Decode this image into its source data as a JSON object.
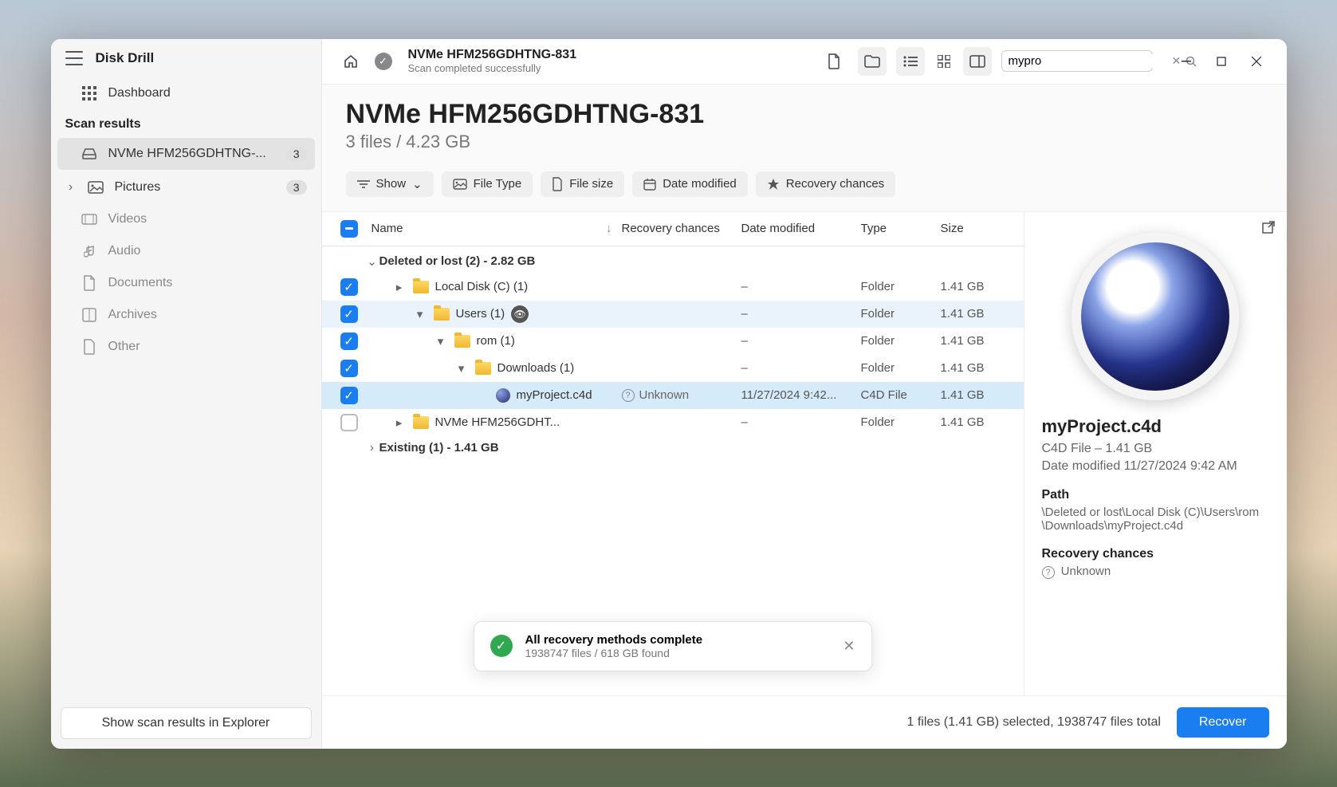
{
  "app": {
    "title": "Disk Drill"
  },
  "sidebar": {
    "dashboard": "Dashboard",
    "section": "Scan results",
    "items": [
      {
        "label": "NVMe HFM256GDHTNG-...",
        "badge": "3"
      },
      {
        "label": "Pictures",
        "badge": "3"
      },
      {
        "label": "Videos"
      },
      {
        "label": "Audio"
      },
      {
        "label": "Documents"
      },
      {
        "label": "Archives"
      },
      {
        "label": "Other"
      }
    ],
    "explorer_button": "Show scan results in Explorer"
  },
  "topbar": {
    "breadcrumb_title": "NVMe HFM256GDHTNG-831",
    "breadcrumb_sub": "Scan completed successfully",
    "search_value": "mypro"
  },
  "header": {
    "title": "NVMe HFM256GDHTNG-831",
    "subtitle": "3 files / 4.23 GB"
  },
  "filters": {
    "show": "Show",
    "file_type": "File Type",
    "file_size": "File size",
    "date_modified": "Date modified",
    "recovery": "Recovery chances"
  },
  "columns": {
    "name": "Name",
    "recovery": "Recovery chances",
    "date": "Date modified",
    "type": "Type",
    "size": "Size"
  },
  "groups": [
    {
      "label": "Deleted or lost (2) - 2.82 GB"
    },
    {
      "label": "Existing (1) - 1.41 GB"
    }
  ],
  "rows": [
    {
      "name": "Local Disk (C) (1)",
      "rec": "",
      "date": "–",
      "type": "Folder",
      "size": "1.41 GB",
      "indent": 1,
      "checked": true,
      "kind": "folder",
      "chev": "▸"
    },
    {
      "name": "Users (1)",
      "rec": "",
      "date": "–",
      "type": "Folder",
      "size": "1.41 GB",
      "indent": 2,
      "checked": true,
      "kind": "folder",
      "chev": "▾",
      "eye": true,
      "hover": true
    },
    {
      "name": "rom (1)",
      "rec": "",
      "date": "–",
      "type": "Folder",
      "size": "1.41 GB",
      "indent": 3,
      "checked": true,
      "kind": "folder",
      "chev": "▾"
    },
    {
      "name": "Downloads (1)",
      "rec": "",
      "date": "–",
      "type": "Folder",
      "size": "1.41 GB",
      "indent": 4,
      "checked": true,
      "kind": "folder",
      "chev": "▾"
    },
    {
      "name": "myProject.c4d",
      "rec": "Unknown",
      "date": "11/27/2024 9:42...",
      "type": "C4D File",
      "size": "1.41 GB",
      "indent": 5,
      "checked": true,
      "kind": "file",
      "selected": true
    },
    {
      "name": "NVMe HFM256GDHT...",
      "rec": "",
      "date": "–",
      "type": "Folder",
      "size": "1.41 GB",
      "indent": 1,
      "checked": false,
      "kind": "folder",
      "chev": "▸"
    }
  ],
  "toast": {
    "title": "All recovery methods complete",
    "sub": "1938747 files / 618 GB found"
  },
  "details": {
    "title": "myProject.c4d",
    "meta1": "C4D File – 1.41 GB",
    "meta2": "Date modified 11/27/2024 9:42 AM",
    "path_label": "Path",
    "path_value": "\\Deleted or lost\\Local Disk (C)\\Users\\rom\\Downloads\\myProject.c4d",
    "rec_label": "Recovery chances",
    "rec_value": "Unknown"
  },
  "footer": {
    "status": "1 files (1.41 GB) selected, 1938747 files total",
    "recover": "Recover"
  }
}
